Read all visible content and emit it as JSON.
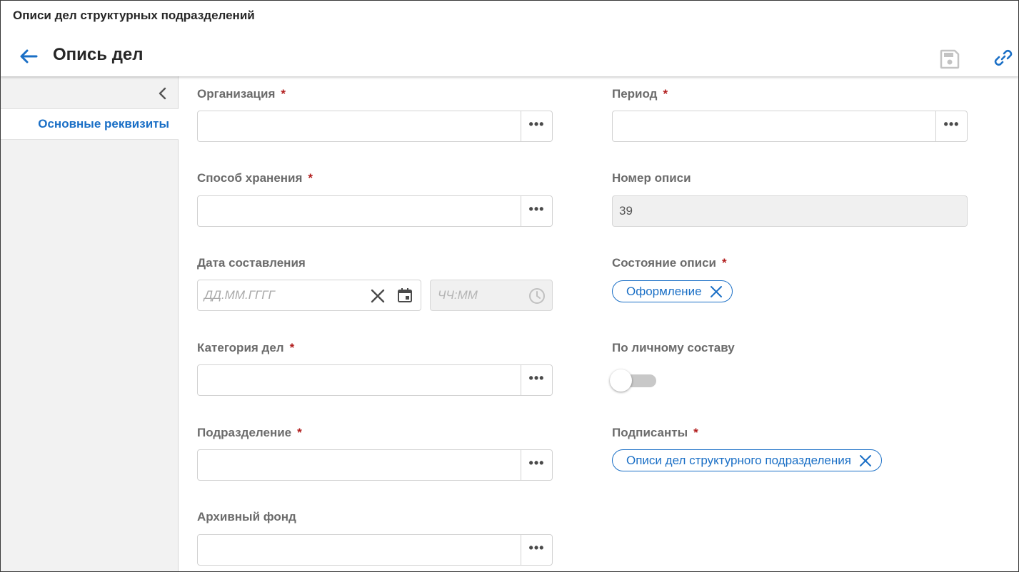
{
  "header": {
    "breadcrumb": "Описи дел структурных подразделений",
    "title": "Опись дел"
  },
  "sidebar": {
    "items": [
      {
        "label": "Основные реквизиты",
        "active": true
      }
    ]
  },
  "form": {
    "organization": {
      "label": "Организация",
      "required": "*",
      "value": ""
    },
    "storage_method": {
      "label": "Способ хранения",
      "required": "*",
      "value": ""
    },
    "compile_date": {
      "label": "Дата составления",
      "date_placeholder": "ДД.ММ.ГГГГ",
      "time_placeholder": "ЧЧ:ММ"
    },
    "case_category": {
      "label": "Категория дел",
      "required": "*",
      "value": ""
    },
    "department": {
      "label": "Подразделение",
      "required": "*",
      "value": ""
    },
    "archive_fund": {
      "label": "Архивный фонд",
      "value": ""
    },
    "period": {
      "label": "Период",
      "required": "*",
      "value": ""
    },
    "inventory_number": {
      "label": "Номер описи",
      "value": "39"
    },
    "inventory_state": {
      "label": "Состояние описи",
      "required": "*",
      "chip": "Оформление"
    },
    "personnel": {
      "label": "По личному составу",
      "enabled": false
    },
    "signers": {
      "label": "Подписанты",
      "required": "*",
      "chip": "Описи дел структурного подразделения"
    }
  },
  "colors": {
    "accent": "#1a6fc6",
    "required": "#b11c1c",
    "label": "#6b6b6b"
  }
}
